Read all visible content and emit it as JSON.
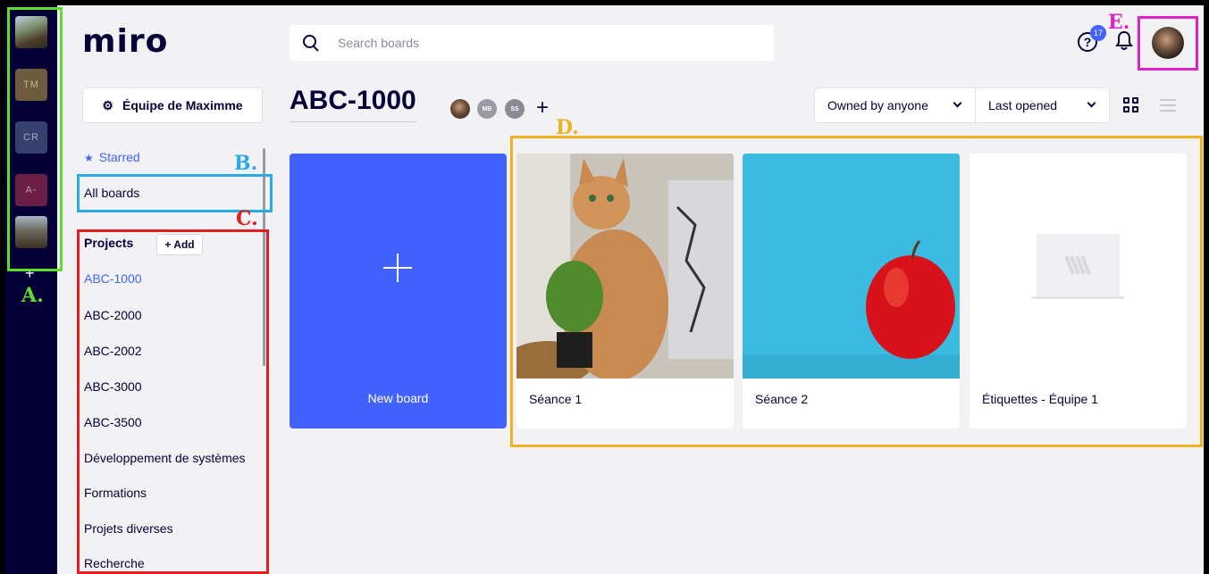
{
  "rail": {
    "teams": [
      {
        "initials": ""
      },
      {
        "initials": "TM"
      },
      {
        "initials": "CR"
      },
      {
        "initials": "A-"
      },
      {
        "initials": ""
      }
    ],
    "add_label": "+"
  },
  "header": {
    "logo": "miro",
    "search_placeholder": "Search boards",
    "help_symbol": "?",
    "notification_count": "17"
  },
  "subheader": {
    "team_name": "Équipe de Maximme",
    "board_title": "ABC-1000",
    "members": [
      "",
      "MB",
      "SS"
    ],
    "add_member": "+",
    "owner_filter": "Owned by anyone",
    "sort_filter": "Last opened"
  },
  "sidebar": {
    "starred": "Starred",
    "all_boards": "All boards",
    "projects_title": "Projects",
    "add_project": "+ Add",
    "projects": [
      "ABC-1000",
      "ABC-2000",
      "ABC-2002",
      "ABC-3000",
      "ABC-3500",
      "Développement de systèmes",
      "Formations",
      "Projets diverses",
      "Recherche"
    ]
  },
  "boards": {
    "new_board_label": "New board",
    "items": [
      {
        "name": "Séance 1"
      },
      {
        "name": "Séance 2"
      },
      {
        "name": "Étiquettes - Équipe 1"
      }
    ]
  },
  "annotations": {
    "a": "A.",
    "b": "B.",
    "c": "C.",
    "d": "D.",
    "e": "E."
  },
  "colors": {
    "accent": "#4262ff",
    "rail": "#050038",
    "ann_a": "#5ae02a",
    "ann_b": "#2aa9e8",
    "ann_c": "#e02020",
    "ann_d": "#f0b21e",
    "ann_e": "#e020c8"
  }
}
